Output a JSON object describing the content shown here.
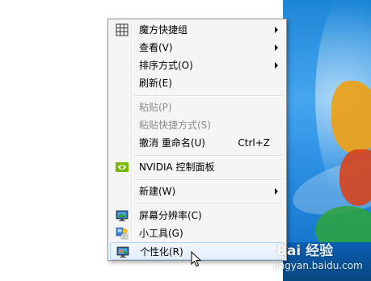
{
  "context_menu": {
    "items": [
      {
        "label": "魔方快捷组",
        "icon": "grid-icon",
        "submenu": true,
        "enabled": true
      },
      {
        "label": "查看(V)",
        "submenu": true,
        "enabled": true
      },
      {
        "label": "排序方式(O)",
        "submenu": true,
        "enabled": true
      },
      {
        "label": "刷新(E)",
        "enabled": true
      },
      {
        "label": "粘贴(P)",
        "enabled": false
      },
      {
        "label": "粘贴快捷方式(S)",
        "enabled": false
      },
      {
        "label": "撤消 重命名(U)",
        "shortcut": "Ctrl+Z",
        "enabled": true
      },
      {
        "label": "NVIDIA 控制面板",
        "icon": "nvidia-icon",
        "enabled": true
      },
      {
        "label": "新建(W)",
        "submenu": true,
        "enabled": true
      },
      {
        "label": "屏幕分辨率(C)",
        "icon": "monitor-icon",
        "enabled": true
      },
      {
        "label": "小工具(G)",
        "icon": "gadgets-icon",
        "enabled": true
      },
      {
        "label": "个性化(R)",
        "icon": "personalize-icon",
        "enabled": true,
        "highlighted": true
      }
    ]
  },
  "watermark": {
    "logo": "Bai 经验",
    "url": "jingyan.baidu.com"
  },
  "colors": {
    "menu_bg": "#f5f5f5",
    "disabled_text": "#8d8d8d",
    "highlight_border": "#aecff7",
    "desktop_blue": "#1c86d6"
  }
}
